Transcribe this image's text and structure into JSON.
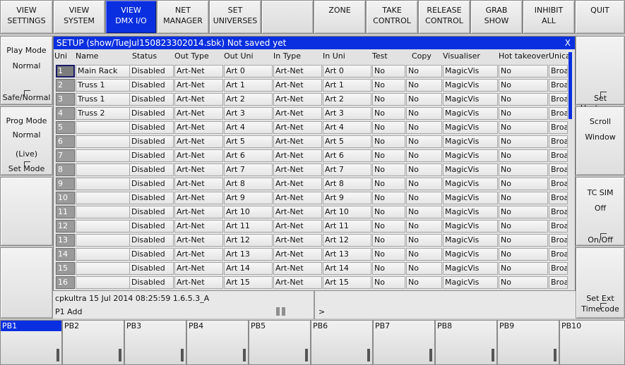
{
  "top_bar": [
    {
      "line1": "VIEW",
      "line2": "SETTINGS"
    },
    {
      "line1": "VIEW",
      "line2": "SYSTEM"
    },
    {
      "line1": "VIEW",
      "line2": "DMX I/O"
    },
    {
      "line1": "NET",
      "line2": "MANAGER"
    },
    {
      "line1": "SET",
      "line2": "UNIVERSES"
    },
    {
      "line1": "",
      "line2": ""
    },
    {
      "line1": "ZONE",
      "line2": ""
    },
    {
      "line1": "TAKE",
      "line2": "CONTROL"
    },
    {
      "line1": "RELEASE",
      "line2": "CONTROL"
    },
    {
      "line1": "GRAB",
      "line2": "SHOW"
    },
    {
      "line1": "INHIBIT",
      "line2": "ALL"
    },
    {
      "line1": "QUIT",
      "line2": ""
    }
  ],
  "left_panel": {
    "play_mode": {
      "title": "Play Mode",
      "value": "Normal",
      "action": "Safe/Normal"
    },
    "prog_mode": {
      "title": "Prog Mode",
      "value": "Normal",
      "sub": "(Live)",
      "action": "Set Mode"
    }
  },
  "right_panel": {
    "hostname": {
      "action": "Set Hostname"
    },
    "scroll": {
      "line1": "Scroll",
      "line2": "Window"
    },
    "tc_sim": {
      "title": "TC SIM",
      "value": "Off",
      "action": "On/Off"
    },
    "ext_time": {
      "line1": "Set Ext",
      "line2": "Timecode"
    }
  },
  "setup_window": {
    "title": "SETUP (show/TueJul150823302014.sbk) Not saved yet",
    "close": "X",
    "columns": [
      "Uni",
      "Name",
      "Status",
      "Out Type",
      "Out Uni",
      "In Type",
      "In Uni",
      "Test",
      "Copy",
      "Visualiser",
      "Hot takeover",
      "Unica"
    ],
    "rows": [
      [
        "1",
        "Main Rack",
        "Disabled",
        "Art-Net",
        "Art 0",
        "Art-Net",
        "Art 0",
        "No",
        "No",
        "MagicVis",
        "No",
        "Broa"
      ],
      [
        "2",
        "Truss 1",
        "Disabled",
        "Art-Net",
        "Art 1",
        "Art-Net",
        "Art 1",
        "No",
        "No",
        "MagicVis",
        "No",
        "Broa"
      ],
      [
        "3",
        "Truss 1",
        "Disabled",
        "Art-Net",
        "Art 2",
        "Art-Net",
        "Art 2",
        "No",
        "No",
        "MagicVis",
        "No",
        "Broa"
      ],
      [
        "4",
        "Truss 2",
        "Disabled",
        "Art-Net",
        "Art 3",
        "Art-Net",
        "Art 3",
        "No",
        "No",
        "MagicVis",
        "No",
        "Broa"
      ],
      [
        "5",
        "",
        "Disabled",
        "Art-Net",
        "Art 4",
        "Art-Net",
        "Art 4",
        "No",
        "No",
        "MagicVis",
        "No",
        "Broa"
      ],
      [
        "6",
        "",
        "Disabled",
        "Art-Net",
        "Art 5",
        "Art-Net",
        "Art 5",
        "No",
        "No",
        "MagicVis",
        "No",
        "Broa"
      ],
      [
        "7",
        "",
        "Disabled",
        "Art-Net",
        "Art 6",
        "Art-Net",
        "Art 6",
        "No",
        "No",
        "MagicVis",
        "No",
        "Broa"
      ],
      [
        "8",
        "",
        "Disabled",
        "Art-Net",
        "Art 7",
        "Art-Net",
        "Art 7",
        "No",
        "No",
        "MagicVis",
        "No",
        "Broa"
      ],
      [
        "9",
        "",
        "Disabled",
        "Art-Net",
        "Art 8",
        "Art-Net",
        "Art 8",
        "No",
        "No",
        "MagicVis",
        "No",
        "Broa"
      ],
      [
        "10",
        "",
        "Disabled",
        "Art-Net",
        "Art 9",
        "Art-Net",
        "Art 9",
        "No",
        "No",
        "MagicVis",
        "No",
        "Broa"
      ],
      [
        "11",
        "",
        "Disabled",
        "Art-Net",
        "Art 10",
        "Art-Net",
        "Art 10",
        "No",
        "No",
        "MagicVis",
        "No",
        "Broa"
      ],
      [
        "12",
        "",
        "Disabled",
        "Art-Net",
        "Art 11",
        "Art-Net",
        "Art 11",
        "No",
        "No",
        "MagicVis",
        "No",
        "Broa"
      ],
      [
        "13",
        "",
        "Disabled",
        "Art-Net",
        "Art 12",
        "Art-Net",
        "Art 12",
        "No",
        "No",
        "MagicVis",
        "No",
        "Broa"
      ],
      [
        "14",
        "",
        "Disabled",
        "Art-Net",
        "Art 13",
        "Art-Net",
        "Art 13",
        "No",
        "No",
        "MagicVis",
        "No",
        "Broa"
      ],
      [
        "15",
        "",
        "Disabled",
        "Art-Net",
        "Art 14",
        "Art-Net",
        "Art 14",
        "No",
        "No",
        "MagicVis",
        "No",
        "Broa"
      ],
      [
        "16",
        "",
        "Disabled",
        "Art-Net",
        "Art 15",
        "Art-Net",
        "Art 15",
        "No",
        "No",
        "MagicVis",
        "No",
        "Broa"
      ]
    ]
  },
  "status_bar": {
    "line1": "cpkultra 15 Jul 2014 08:25:59 1.6.5.3_A",
    "line2": "P1  Add",
    "prompt": ">"
  },
  "playbacks": [
    "PB1",
    "PB2",
    "PB3",
    "PB4",
    "PB5",
    "PB6",
    "PB7",
    "PB8",
    "PB9",
    "PB10"
  ],
  "colors": {
    "accent": "#0a2fe0"
  }
}
